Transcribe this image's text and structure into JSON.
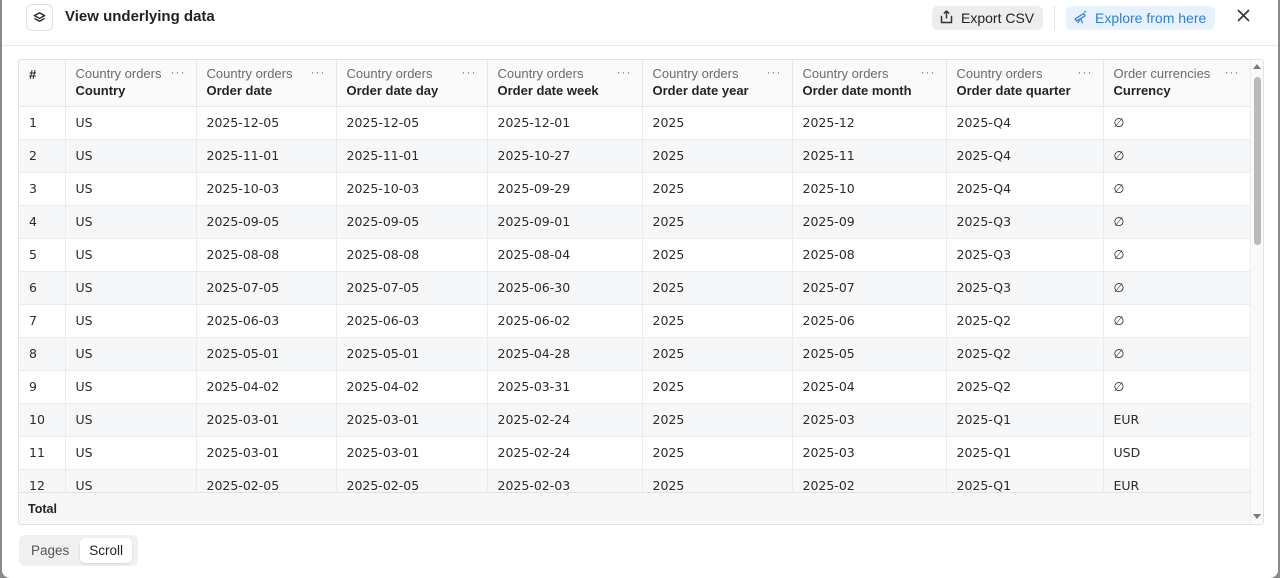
{
  "header": {
    "title": "View underlying data",
    "export_label": "Export CSV",
    "explore_label": "Explore from here"
  },
  "table": {
    "index_header": "#",
    "columns": [
      {
        "source": "Country orders",
        "name": "Country"
      },
      {
        "source": "Country orders",
        "name": "Order date"
      },
      {
        "source": "Country orders",
        "name": "Order date day"
      },
      {
        "source": "Country orders",
        "name": "Order date week"
      },
      {
        "source": "Country orders",
        "name": "Order date year"
      },
      {
        "source": "Country orders",
        "name": "Order date month"
      },
      {
        "source": "Country orders",
        "name": "Order date quarter"
      },
      {
        "source": "Order currencies",
        "name": "Currency"
      }
    ],
    "menu_glyph": "···",
    "rows": [
      [
        "1",
        "US",
        "2025-12-05",
        "2025-12-05",
        "2025-12-01",
        "2025",
        "2025-12",
        "2025-Q4",
        "∅"
      ],
      [
        "2",
        "US",
        "2025-11-01",
        "2025-11-01",
        "2025-10-27",
        "2025",
        "2025-11",
        "2025-Q4",
        "∅"
      ],
      [
        "3",
        "US",
        "2025-10-03",
        "2025-10-03",
        "2025-09-29",
        "2025",
        "2025-10",
        "2025-Q4",
        "∅"
      ],
      [
        "4",
        "US",
        "2025-09-05",
        "2025-09-05",
        "2025-09-01",
        "2025",
        "2025-09",
        "2025-Q3",
        "∅"
      ],
      [
        "5",
        "US",
        "2025-08-08",
        "2025-08-08",
        "2025-08-04",
        "2025",
        "2025-08",
        "2025-Q3",
        "∅"
      ],
      [
        "6",
        "US",
        "2025-07-05",
        "2025-07-05",
        "2025-06-30",
        "2025",
        "2025-07",
        "2025-Q3",
        "∅"
      ],
      [
        "7",
        "US",
        "2025-06-03",
        "2025-06-03",
        "2025-06-02",
        "2025",
        "2025-06",
        "2025-Q2",
        "∅"
      ],
      [
        "8",
        "US",
        "2025-05-01",
        "2025-05-01",
        "2025-04-28",
        "2025",
        "2025-05",
        "2025-Q2",
        "∅"
      ],
      [
        "9",
        "US",
        "2025-04-02",
        "2025-04-02",
        "2025-03-31",
        "2025",
        "2025-04",
        "2025-Q2",
        "∅"
      ],
      [
        "10",
        "US",
        "2025-03-01",
        "2025-03-01",
        "2025-02-24",
        "2025",
        "2025-03",
        "2025-Q1",
        "EUR"
      ],
      [
        "11",
        "US",
        "2025-03-01",
        "2025-03-01",
        "2025-02-24",
        "2025",
        "2025-03",
        "2025-Q1",
        "USD"
      ],
      [
        "12",
        "US",
        "2025-02-05",
        "2025-02-05",
        "2025-02-03",
        "2025",
        "2025-02",
        "2025-Q1",
        "EUR"
      ]
    ],
    "total_label": "Total"
  },
  "view_toggle": {
    "options": [
      "Pages",
      "Scroll"
    ],
    "selected": "Scroll"
  },
  "colors": {
    "explore_accent": "#2f7fd8",
    "explore_bg": "#e8f2fd"
  }
}
